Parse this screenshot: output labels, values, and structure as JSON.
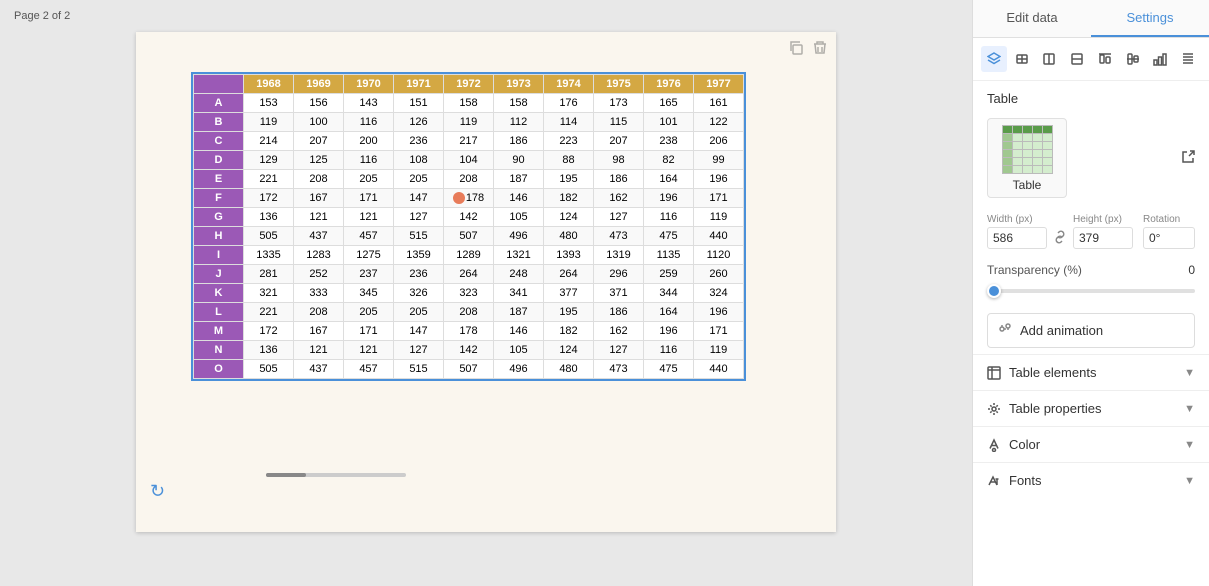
{
  "page": {
    "label": "Page 2 of 2"
  },
  "tabs": [
    {
      "id": "edit-data",
      "label": "Edit data",
      "active": false
    },
    {
      "id": "settings",
      "label": "Settings",
      "active": true
    }
  ],
  "section": {
    "title": "Table"
  },
  "table_preview_label": "Table",
  "toolbar_icons": [
    "layers",
    "align-left",
    "align-center",
    "align-right",
    "align-top",
    "align-middle",
    "chart",
    "list"
  ],
  "dimensions": {
    "width_label": "Width (px)",
    "height_label": "Height (px)",
    "rotation_label": "Rotation",
    "width_value": "586",
    "height_value": "379",
    "rotation_value": "0°"
  },
  "transparency": {
    "label": "Transparency (%)",
    "value": "0",
    "percent": 0
  },
  "add_animation": {
    "label": "Add animation"
  },
  "collapsible_sections": [
    {
      "id": "table-elements",
      "icon": "table",
      "label": "Table elements"
    },
    {
      "id": "table-properties",
      "icon": "gear",
      "label": "Table properties"
    },
    {
      "id": "color",
      "icon": "color",
      "label": "Color"
    },
    {
      "id": "fonts",
      "icon": "font",
      "label": "Fonts"
    }
  ],
  "data_table": {
    "headers": [
      "",
      "1968",
      "1969",
      "1970",
      "1971",
      "1972",
      "1973",
      "1974",
      "1975",
      "1976",
      "1977"
    ],
    "rows": [
      {
        "label": "A",
        "values": [
          "153",
          "156",
          "143",
          "151",
          "158",
          "158",
          "176",
          "173",
          "165",
          "161"
        ]
      },
      {
        "label": "B",
        "values": [
          "119",
          "100",
          "116",
          "126",
          "119",
          "112",
          "114",
          "115",
          "101",
          "122"
        ]
      },
      {
        "label": "C",
        "values": [
          "214",
          "207",
          "200",
          "236",
          "217",
          "186",
          "223",
          "207",
          "238",
          "206"
        ]
      },
      {
        "label": "D",
        "values": [
          "129",
          "125",
          "116",
          "108",
          "104",
          "90",
          "88",
          "98",
          "82",
          "99"
        ]
      },
      {
        "label": "E",
        "values": [
          "221",
          "208",
          "205",
          "205",
          "208",
          "187",
          "195",
          "186",
          "164",
          "196"
        ]
      },
      {
        "label": "F",
        "values": [
          "172",
          "167",
          "171",
          "147",
          "178",
          "146",
          "182",
          "162",
          "196",
          "171"
        ],
        "highlight_col": 4
      },
      {
        "label": "G",
        "values": [
          "136",
          "121",
          "121",
          "127",
          "142",
          "105",
          "124",
          "127",
          "116",
          "119"
        ]
      },
      {
        "label": "H",
        "values": [
          "505",
          "437",
          "457",
          "515",
          "507",
          "496",
          "480",
          "473",
          "475",
          "440"
        ]
      },
      {
        "label": "I",
        "values": [
          "1335",
          "1283",
          "1275",
          "1359",
          "1289",
          "1321",
          "1393",
          "1319",
          "1135",
          "1120"
        ]
      },
      {
        "label": "J",
        "values": [
          "281",
          "252",
          "237",
          "236",
          "264",
          "248",
          "264",
          "296",
          "259",
          "260"
        ]
      },
      {
        "label": "K",
        "values": [
          "321",
          "333",
          "345",
          "326",
          "323",
          "341",
          "377",
          "371",
          "344",
          "324"
        ]
      },
      {
        "label": "L",
        "values": [
          "221",
          "208",
          "205",
          "205",
          "208",
          "187",
          "195",
          "186",
          "164",
          "196"
        ]
      },
      {
        "label": "M",
        "values": [
          "172",
          "167",
          "171",
          "147",
          "178",
          "146",
          "182",
          "162",
          "196",
          "171"
        ]
      },
      {
        "label": "N",
        "values": [
          "136",
          "121",
          "121",
          "127",
          "142",
          "105",
          "124",
          "127",
          "116",
          "119"
        ]
      },
      {
        "label": "O",
        "values": [
          "505",
          "437",
          "457",
          "515",
          "507",
          "496",
          "480",
          "473",
          "475",
          "440"
        ]
      }
    ]
  }
}
